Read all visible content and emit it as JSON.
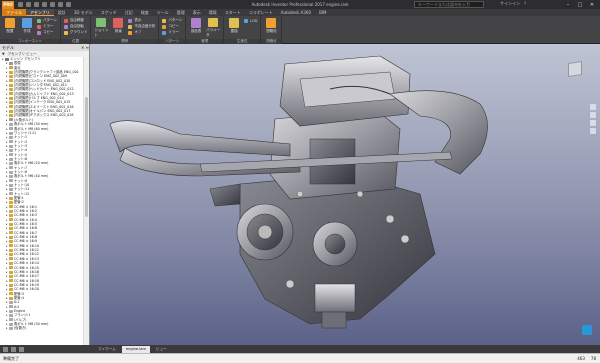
{
  "titlebar": {
    "title": "Autodesk Inventor Professional 2017  engine.iam",
    "search_placeholder": "キーワードまたは語句を入力",
    "user_label": "サインイン",
    "logo": "PRO"
  },
  "tabs": [
    "ファイル",
    "アセンブリ",
    "設計",
    "3D モデル",
    "スケッチ",
    "注記",
    "検査",
    "ツール",
    "管理",
    "表示",
    "環境",
    "スタート",
    "コラボレート",
    "Autodesk A360",
    "BIM"
  ],
  "ribbon": {
    "panels": [
      {
        "title": "コンポーネント",
        "big": [
          "配置",
          "作成"
        ],
        "small": [
          "パターン",
          "ミラー",
          "コピー"
        ]
      },
      {
        "title": "位置",
        "small": [
          "自由移動",
          "自由回転",
          "グラウンド"
        ]
      },
      {
        "title": "関係",
        "big": [
          "ジョイント",
          "拘束"
        ],
        "small": [
          "表示",
          "不自由度分析",
          "オフ"
        ]
      },
      {
        "title": "パターン",
        "small": [
          "パターン",
          "コピー",
          "ミラー"
        ]
      },
      {
        "title": "管理",
        "big": [
          "部品表",
          "パラメータ"
        ],
        "small": []
      },
      {
        "title": "生産性",
        "big": [
          "置換"
        ],
        "small": [
          "LOD"
        ]
      },
      {
        "title": "簡略化",
        "big": [
          "簡略化"
        ],
        "small": []
      }
    ]
  },
  "browser": {
    "title": "モデル",
    "view_label": "アセンブリ ビュー",
    "items": [
      {
        "label": "エンジン アセンブリ",
        "indent": 0,
        "color": "#777"
      },
      {
        "label": "表現",
        "indent": 1,
        "color": "#999"
      },
      {
        "label": "原点",
        "indent": 1,
        "color": "#caa24a"
      },
      {
        "label": "[内燃機関]クランクシャフト部品 ENG_001",
        "indent": 1,
        "color": "#d4a73a"
      },
      {
        "label": "[内燃機関]ピストン ENG_002_009",
        "indent": 1,
        "color": "#d4a73a"
      },
      {
        "label": "[内燃機関]コンロッド ENG_002_010",
        "indent": 1,
        "color": "#d4a73a"
      },
      {
        "label": "[内燃機関]シリンダ ENG_002_011",
        "indent": 1,
        "color": "#d4a73a"
      },
      {
        "label": "[内燃機関]ヘッドカバー ENG_002_012",
        "indent": 1,
        "color": "#d4a73a"
      },
      {
        "label": "[内燃機関]カムシャフト ENG_002_013",
        "indent": 1,
        "color": "#d4a73a"
      },
      {
        "label": "[内燃機関]バルブ ENG_002_014",
        "indent": 1,
        "color": "#d4a73a"
      },
      {
        "label": "[内燃機関]インテーク ENG_002_015",
        "indent": 1,
        "color": "#d4a73a"
      },
      {
        "label": "[内燃機関]エキゾースト ENG_002_016",
        "indent": 1,
        "color": "#d4a73a"
      },
      {
        "label": "[内燃機関]オイルパン ENG_002_017",
        "indent": 1,
        "color": "#d4a73a"
      },
      {
        "label": "[内燃機関]ギアボックス ENG_002_018",
        "indent": 1,
        "color": "#d4a73a"
      },
      {
        "label": "(六角ボルト)",
        "indent": 1,
        "color": "#999"
      },
      {
        "label": "角ボルト M8 (30 mm)",
        "indent": 1,
        "color": "#aaa"
      },
      {
        "label": "角ボルト M8 (60 mm)",
        "indent": 1,
        "color": "#aaa"
      },
      {
        "label": "ワッシャ (1:1)",
        "indent": 1,
        "color": "#aaa"
      },
      {
        "label": "ナット:1",
        "indent": 1,
        "color": "#aaa"
      },
      {
        "label": "ナット:2",
        "indent": 1,
        "color": "#aaa"
      },
      {
        "label": "ナット:3",
        "indent": 1,
        "color": "#aaa"
      },
      {
        "label": "ナット:4",
        "indent": 1,
        "color": "#aaa"
      },
      {
        "label": "ナット:5",
        "indent": 1,
        "color": "#aaa"
      },
      {
        "label": "ナット:6",
        "indent": 1,
        "color": "#aaa"
      },
      {
        "label": "角ボルト M6 (20 mm)",
        "indent": 1,
        "color": "#aaa"
      },
      {
        "label": "ナット:7",
        "indent": 1,
        "color": "#aaa"
      },
      {
        "label": "ナット:8",
        "indent": 1,
        "color": "#aaa"
      },
      {
        "label": "角ボルト M6 (40 mm)",
        "indent": 1,
        "color": "#aaa"
      },
      {
        "label": "ナット:9",
        "indent": 1,
        "color": "#aaa"
      },
      {
        "label": "ナット:10",
        "indent": 1,
        "color": "#aaa"
      },
      {
        "label": "ナット:11",
        "indent": 1,
        "color": "#aaa"
      },
      {
        "label": "ナット:12",
        "indent": 1,
        "color": "#aaa"
      },
      {
        "label": "配管:1",
        "indent": 1,
        "color": "#d4a73a"
      },
      {
        "label": "配管:2",
        "indent": 1,
        "color": "#d4a73a"
      },
      {
        "label": "CC:M6 × 16:1",
        "indent": 1,
        "color": "#d4a73a"
      },
      {
        "label": "CC:M6 × 16:2",
        "indent": 1,
        "color": "#d4a73a"
      },
      {
        "label": "CC:M6 × 16:3",
        "indent": 1,
        "color": "#d4a73a"
      },
      {
        "label": "CC:M6 × 16:4",
        "indent": 1,
        "color": "#d4a73a"
      },
      {
        "label": "CC:M6 × 16:5",
        "indent": 1,
        "color": "#d4a73a"
      },
      {
        "label": "CC:M6 × 16:6",
        "indent": 1,
        "color": "#d4a73a"
      },
      {
        "label": "CC:M6 × 16:7",
        "indent": 1,
        "color": "#d4a73a"
      },
      {
        "label": "CC:M6 × 16:8",
        "indent": 1,
        "color": "#d4a73a"
      },
      {
        "label": "CC:M6 × 16:9",
        "indent": 1,
        "color": "#d4a73a"
      },
      {
        "label": "CC:M6 × 16:10",
        "indent": 1,
        "color": "#d4a73a"
      },
      {
        "label": "CC:M6 × 16:11",
        "indent": 1,
        "color": "#d4a73a"
      },
      {
        "label": "CC:M6 × 16:12",
        "indent": 1,
        "color": "#d4a73a"
      },
      {
        "label": "CC:M6 × 16:13",
        "indent": 1,
        "color": "#d4a73a"
      },
      {
        "label": "CC:M6 × 16:14",
        "indent": 1,
        "color": "#d4a73a"
      },
      {
        "label": "CC:M6 × 16:15",
        "indent": 1,
        "color": "#d4a73a"
      },
      {
        "label": "CC:M6 × 16:16",
        "indent": 1,
        "color": "#d4a73a"
      },
      {
        "label": "CC:M6 × 16:17",
        "indent": 1,
        "color": "#d4a73a"
      },
      {
        "label": "CC:M6 × 16:18",
        "indent": 1,
        "color": "#d4a73a"
      },
      {
        "label": "CC:M6 × 16:19",
        "indent": 1,
        "color": "#d4a73a"
      },
      {
        "label": "CC:M6 × 16:20",
        "indent": 1,
        "color": "#d4a73a"
      },
      {
        "label": "配管:3",
        "indent": 1,
        "color": "#d4a73a"
      },
      {
        "label": "配管:4",
        "indent": 1,
        "color": "#d4a73a"
      },
      {
        "label": "A:1",
        "indent": 1,
        "color": "#aaa"
      },
      {
        "label": "A:2",
        "indent": 1,
        "color": "#aaa"
      },
      {
        "label": "Engine",
        "indent": 1,
        "color": "#aaa"
      },
      {
        "label": "フランジ:1",
        "indent": 1,
        "color": "#aaa"
      },
      {
        "label": "(バルブ)",
        "indent": 1,
        "color": "#aaa"
      },
      {
        "label": "角ボルト M8 (30 mm)",
        "indent": 1,
        "color": "#aaa"
      },
      {
        "label": "(仮置き)",
        "indent": 1,
        "color": "#aaa"
      }
    ]
  },
  "doc_tabs": [
    "マイホーム",
    "engine.iam",
    "ビュー"
  ],
  "status": {
    "left": "準備完了",
    "right_a": "463",
    "right_b": "78"
  },
  "colors": {
    "accent": "#e8891c",
    "viewport_top": "#bfc4d4",
    "viewport_bottom": "#5c6288"
  }
}
